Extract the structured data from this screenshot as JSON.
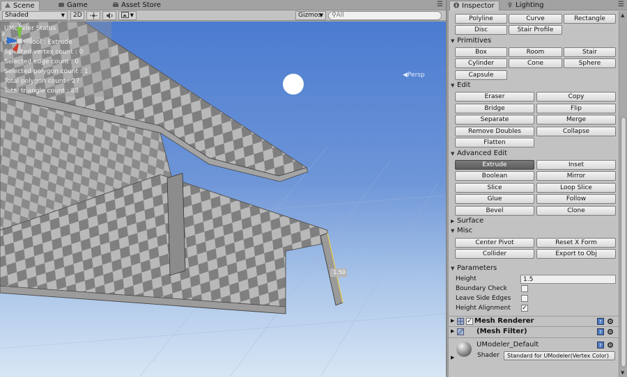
{
  "scene_panel": {
    "tabs": [
      {
        "label": "Scene",
        "icon": "scene-icon"
      },
      {
        "label": "Game",
        "icon": "game-icon"
      },
      {
        "label": "Asset Store",
        "icon": "asset-store-icon"
      }
    ],
    "toolbar": {
      "shading_mode": "Shaded",
      "mode_2d": "2D",
      "lighting_icon": "sun-icon",
      "audio_icon": "speaker-icon",
      "effects_icon": "image-icon",
      "gizmos_label": "Gizmos",
      "search_placeholder": "All"
    },
    "status": {
      "title": "UModeler Status",
      "lines": [
        "Current tool : Extrude",
        "Selected vertex count : 0",
        "Selected edge count : 0",
        "Selected polygon count : 1",
        "Total polygon count : 27",
        "Total triangle count : 88"
      ]
    },
    "gizmo": {
      "labels": [
        "y",
        "z",
        "x"
      ],
      "projection": "Persp"
    },
    "dimension_label": "1.50"
  },
  "inspector": {
    "tabs": [
      {
        "label": "Inspector",
        "icon": "info-icon"
      },
      {
        "label": "Lighting",
        "icon": "light-icon"
      }
    ],
    "top_buttons": [
      "Polyline",
      "Curve",
      "Rectangle",
      "Disc",
      "Stair Profile"
    ],
    "sections": {
      "primitives": {
        "label": "Primitives",
        "buttons": [
          "Box",
          "Room",
          "Stair",
          "Cylinder",
          "Cone",
          "Sphere",
          "Capsule"
        ]
      },
      "edit": {
        "label": "Edit",
        "buttons": [
          "Eraser",
          "Copy",
          "Bridge",
          "Flip",
          "Separate",
          "Merge",
          "Remove Doubles",
          "Collapse",
          "Flatten"
        ]
      },
      "advanced_edit": {
        "label": "Advanced Edit",
        "buttons": [
          "Extrude",
          "Inset",
          "Boolean",
          "Mirror",
          "Slice",
          "Loop Slice",
          "Glue",
          "Follow",
          "Bevel",
          "Clone"
        ],
        "active": "Extrude"
      },
      "surface": {
        "label": "Surface"
      },
      "misc": {
        "label": "Misc",
        "buttons": [
          "Center Pivot",
          "Reset X Form",
          "Collider",
          "Export to Obj"
        ]
      },
      "parameters": {
        "label": "Parameters",
        "height_label": "Height",
        "height_value": "1.5",
        "boundary_check_label": "Boundary Check",
        "boundary_check": false,
        "leave_side_edges_label": "Leave Side Edges",
        "leave_side_edges": false,
        "height_alignment_label": "Height Alignment",
        "height_alignment": true
      }
    },
    "components": {
      "mesh_renderer": "Mesh Renderer",
      "mesh_filter": "(Mesh Filter)",
      "material_name": "UModeler_Default",
      "shader_label": "Shader",
      "shader_value": "Standard for UModeler(Vertex Color)"
    }
  },
  "colors": {
    "sky_top": "#4b7bd0",
    "sky_bottom": "#d8e6f4",
    "active_button": "#666666"
  }
}
